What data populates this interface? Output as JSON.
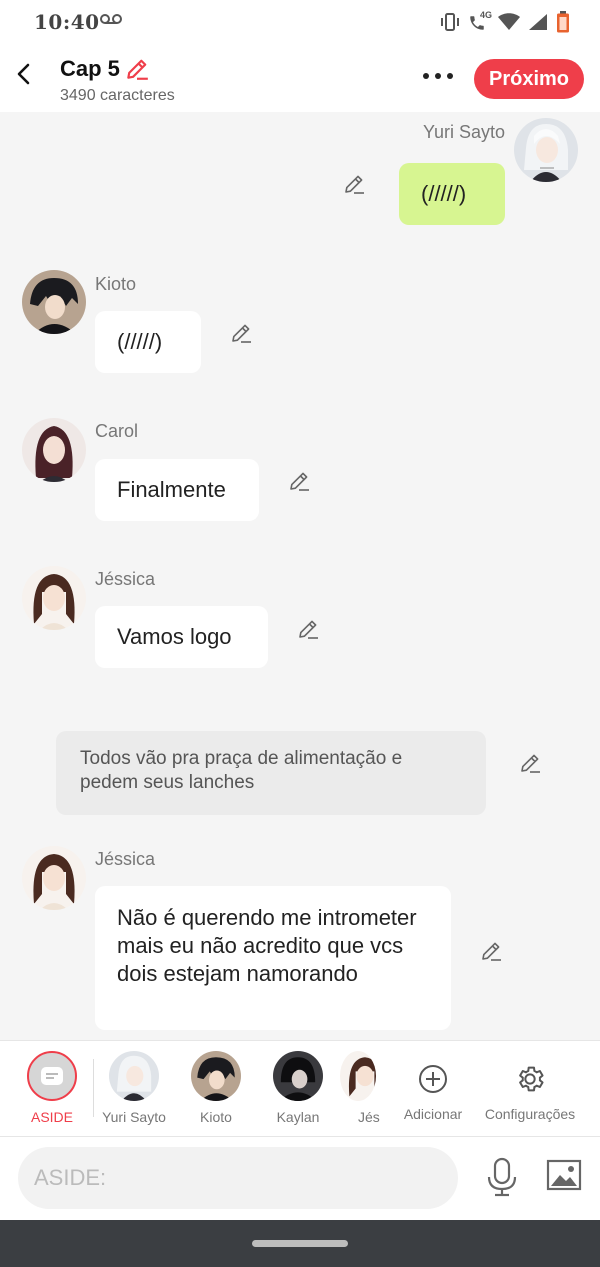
{
  "status_bar": {
    "time": "10:40",
    "icons": [
      "voicemail-icon",
      "vibrate-icon",
      "volte-call-icon",
      "wifi-icon",
      "signal-icon",
      "battery-icon"
    ],
    "network_badge": "4G"
  },
  "header": {
    "chapter_title": "Cap 5",
    "char_count": "3490 caracteres",
    "next_label": "Próximo",
    "accent_color": "#ef3e4a"
  },
  "messages": [
    {
      "author": "Yuri Sayto",
      "text": "(/////)",
      "side": "right"
    },
    {
      "author": "Kioto",
      "text": "(/////)",
      "side": "left"
    },
    {
      "author": "Carol",
      "text": "Finalmente",
      "side": "left"
    },
    {
      "author": "Jéssica",
      "text": "Vamos logo",
      "side": "left"
    },
    {
      "type": "narration",
      "text": "Todos vão pra praça de alimentação e pedem seus lanches"
    },
    {
      "author": "Jéssica",
      "text": "Não é querendo me intrometer mais eu não acredito que vcs dois estejam namorando",
      "side": "left"
    }
  ],
  "characters": {
    "aside": "ASIDE",
    "list": [
      "Yuri Sayto",
      "Kioto",
      "Kaylan",
      "Jés"
    ],
    "add_label": "Adicionar",
    "settings_label": "Configurações"
  },
  "composer": {
    "placeholder": "ASIDE:"
  }
}
